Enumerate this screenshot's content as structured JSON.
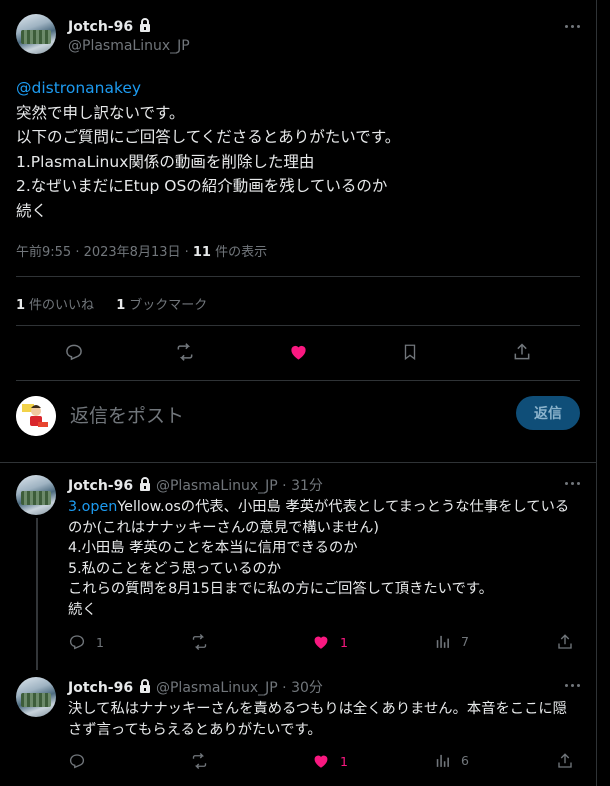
{
  "main": {
    "name": "Jotch-96",
    "handle": "@PlasmaLinux_JP",
    "mention": "@distronanakey",
    "text": "突然で申し訳ないです。\n以下のご質問にご回答してくださるとありがたいです。\n1.PlasmaLinux関係の動画を削除した理由\n2.なぜいまだにEtup OSの紹介動画を残しているのか\n続く",
    "time": "午前9:55 · 2023年8月13日 · ",
    "views_count": "11",
    "views_label": " 件の表示",
    "likes_count": "1",
    "likes_label": "件のいいね",
    "bookmarks_count": "1",
    "bookmarks_label": "ブックマーク"
  },
  "reply_box": {
    "placeholder": "返信をポスト",
    "button": "返信"
  },
  "replies": [
    {
      "name": "Jotch-96",
      "handle": "@PlasmaLinux_JP",
      "sep": " · ",
      "time": "31分",
      "link": "3.open",
      "text": "Yellow.osの代表、小田島 孝英が代表としてまっとうな仕事をしているのか(これはナナッキーさんの意見で構いません)\n4.小田島 孝英のことを本当に信用できるのか\n5.私のことをどう思っているのか\nこれらの質問を8月15日までに私の方にご回答して頂きたいです。\n続く",
      "replies": "1",
      "likes": "1",
      "views": "7"
    },
    {
      "name": "Jotch-96",
      "handle": "@PlasmaLinux_JP",
      "sep": " · ",
      "time": "30分",
      "text": "決して私はナナッキーさんを責めるつもりは全くありません。本音をここに隠さず言ってもらえるとありがたいです。",
      "replies": "",
      "likes": "1",
      "views": "6"
    }
  ],
  "colors": {
    "background": "#000000",
    "text": "#e7e9ea",
    "muted": "#71767b",
    "link": "#1d9bf0",
    "like": "#f91880",
    "reply_button": "#0f4e78"
  },
  "icons": [
    "lock-icon",
    "more-icon",
    "reply-icon",
    "repost-icon",
    "heart-icon",
    "bookmark-icon",
    "share-icon",
    "views-icon"
  ]
}
